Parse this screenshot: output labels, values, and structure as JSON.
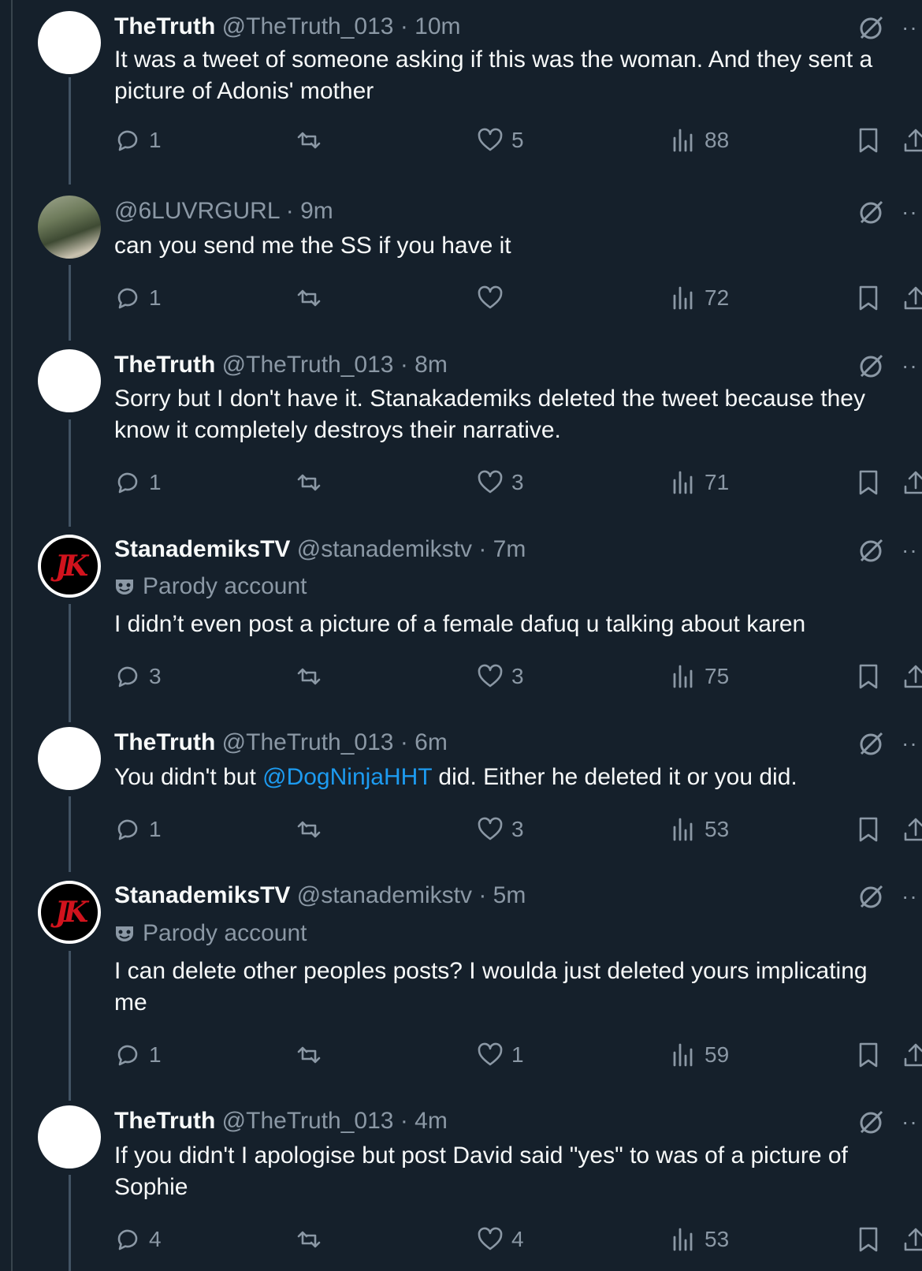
{
  "colors": {
    "background": "#15202b",
    "text": "#f7f9f9",
    "muted": "#8b98a5",
    "link": "#1d9bf0",
    "thread_line": "#425364"
  },
  "posts": [
    {
      "name": "TheTruth",
      "handle": "@TheTruth_013",
      "sep": "·",
      "time": "10m",
      "avatar": "white-avatar",
      "text": "It was a tweet of someone asking if this was the woman. And they sent a picture of Adonis' mother",
      "replies": "1",
      "reposts": "",
      "likes": "5",
      "views": "88"
    },
    {
      "name": "",
      "handle": "@6LUVRGURL",
      "sep": "·",
      "time": "9m",
      "avatar": "photo-avatar",
      "text": "can you send me the SS if you have it",
      "replies": "1",
      "reposts": "",
      "likes": "",
      "views": "72"
    },
    {
      "name": "TheTruth",
      "handle": "@TheTruth_013",
      "sep": "·",
      "time": "8m",
      "avatar": "white-avatar",
      "text": "Sorry but I don't have it. Stanakademiks deleted the tweet because they know it completely destroys their narrative.",
      "replies": "1",
      "reposts": "",
      "likes": "3",
      "views": "71"
    },
    {
      "name": "StanademiksTV",
      "handle": "@stanademikstv",
      "sep": "·",
      "time": "7m",
      "avatar": "jk-avatar",
      "avatar_text": "JK",
      "parody": "Parody account",
      "text": "I didn’t even post a picture of a female dafuq u talking about karen",
      "replies": "3",
      "reposts": "",
      "likes": "3",
      "views": "75"
    },
    {
      "name": "TheTruth",
      "handle": "@TheTruth_013",
      "sep": "·",
      "time": "6m",
      "avatar": "white-avatar",
      "text_before": "You didn't but ",
      "mention": "@DogNinjaHHT",
      "text_after": " did. Either he deleted it or you did.",
      "replies": "1",
      "reposts": "",
      "likes": "3",
      "views": "53"
    },
    {
      "name": "StanademiksTV",
      "handle": "@stanademikstv",
      "sep": "·",
      "time": "5m",
      "avatar": "jk-avatar",
      "avatar_text": "JK",
      "parody": "Parody account",
      "text": "I can delete other peoples posts? I woulda just deleted yours implicating me",
      "replies": "1",
      "reposts": "",
      "likes": "1",
      "views": "59"
    },
    {
      "name": "TheTruth",
      "handle": "@TheTruth_013",
      "sep": "·",
      "time": "4m",
      "avatar": "white-avatar",
      "text": "If you didn't I apologise but post David said \"yes\" to was of a picture of Sophie",
      "replies": "4",
      "reposts": "",
      "likes": "4",
      "views": "53"
    }
  ]
}
